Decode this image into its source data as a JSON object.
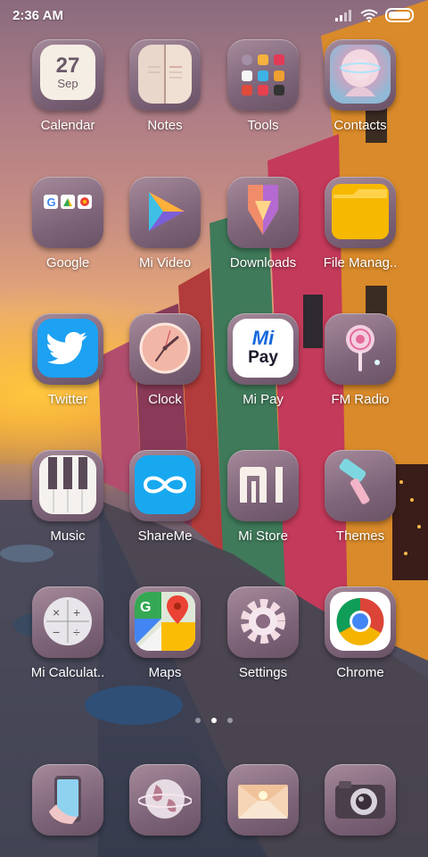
{
  "status": {
    "time": "2:36 AM",
    "icons": [
      "signal-icon",
      "wifi-icon",
      "battery-icon"
    ]
  },
  "apps": [
    {
      "name": "Calendar",
      "icon": "calendar-icon",
      "day": "27",
      "month": "Sep"
    },
    {
      "name": "Notes",
      "icon": "notes-icon"
    },
    {
      "name": "Tools",
      "icon": "tools-icon"
    },
    {
      "name": "Contacts",
      "icon": "contacts-icon"
    },
    {
      "name": "Google",
      "icon": "google-folder-icon"
    },
    {
      "name": "Mi Video",
      "icon": "mi-video-icon"
    },
    {
      "name": "Downloads",
      "icon": "downloads-icon"
    },
    {
      "name": "File Manag..",
      "icon": "file-manager-icon"
    },
    {
      "name": "Twitter",
      "icon": "twitter-icon"
    },
    {
      "name": "Clock",
      "icon": "clock-icon"
    },
    {
      "name": "Mi Pay",
      "icon": "mi-pay-icon",
      "logo_top": "Mi",
      "logo_bottom": "Pay"
    },
    {
      "name": "FM Radio",
      "icon": "fm-radio-icon"
    },
    {
      "name": "Music",
      "icon": "music-icon"
    },
    {
      "name": "ShareMe",
      "icon": "shareme-icon"
    },
    {
      "name": "Mi Store",
      "icon": "mi-store-icon"
    },
    {
      "name": "Themes",
      "icon": "themes-icon"
    },
    {
      "name": "Mi Calculat..",
      "icon": "calculator-icon"
    },
    {
      "name": "Maps",
      "icon": "maps-icon"
    },
    {
      "name": "Settings",
      "icon": "settings-icon"
    },
    {
      "name": "Chrome",
      "icon": "chrome-icon"
    }
  ],
  "pages": {
    "count": 3,
    "active": 2
  },
  "dock": [
    {
      "icon": "phone-icon"
    },
    {
      "icon": "browser-icon"
    },
    {
      "icon": "messages-icon"
    },
    {
      "icon": "camera-icon"
    }
  ],
  "colors": {
    "accent_blue": "#1da1f2",
    "folder_yellow": "#f6b800",
    "shareme_blue": "#18a8f0"
  }
}
